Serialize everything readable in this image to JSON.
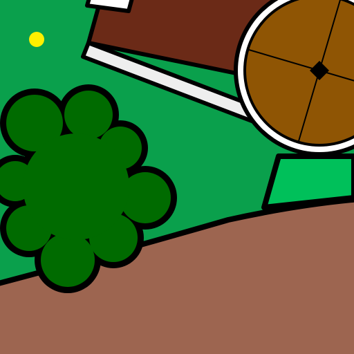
{
  "map": {
    "features": [
      {
        "id": "grass",
        "kind": "grass",
        "color": "#0aa04c"
      },
      {
        "id": "grass-light",
        "kind": "grass",
        "color": "#00c05a"
      },
      {
        "id": "dirt-path",
        "kind": "path",
        "color": "#9d6550"
      },
      {
        "id": "house-roof",
        "kind": "building",
        "color": "#6b2a17"
      },
      {
        "id": "house-wall",
        "kind": "building",
        "color": "#eeeeee"
      },
      {
        "id": "barrel",
        "kind": "barrel",
        "color": "#8f5504"
      },
      {
        "id": "bush",
        "kind": "bush",
        "color": "#006b00"
      },
      {
        "id": "flower",
        "kind": "flower",
        "color": "#fff000"
      }
    ],
    "outline_color": "#000000"
  }
}
